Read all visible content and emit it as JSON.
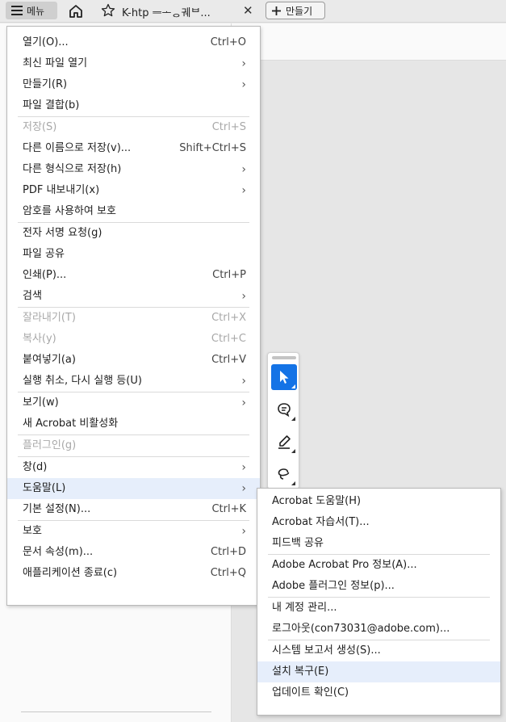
{
  "tabbar": {
    "menu_label": "메뉴",
    "tab_title": "K-htp ᆖᅩᆼ궤ᄇ...",
    "close_glyph": "✕",
    "new_tab_label": "만들기"
  },
  "main_menu": [
    {
      "type": "item",
      "label": "열기(O)...",
      "shortcut": "Ctrl+O"
    },
    {
      "type": "item",
      "label": "최신 파일 열기",
      "submenu": true
    },
    {
      "type": "item",
      "label": "만들기(R)",
      "submenu": true
    },
    {
      "type": "item",
      "label": "파일 결합(b)"
    },
    {
      "type": "sep"
    },
    {
      "type": "item",
      "label": "저장(S)",
      "shortcut": "Ctrl+S",
      "disabled": true
    },
    {
      "type": "item",
      "label": "다른 이름으로 저장(v)...",
      "shortcut": "Shift+Ctrl+S"
    },
    {
      "type": "item",
      "label": "다른 형식으로 저장(h)",
      "submenu": true
    },
    {
      "type": "item",
      "label": "PDF 내보내기(x)",
      "submenu": true
    },
    {
      "type": "item",
      "label": "암호를 사용하여 보호"
    },
    {
      "type": "sep"
    },
    {
      "type": "item",
      "label": "전자 서명 요청(g)"
    },
    {
      "type": "item",
      "label": "파일 공유"
    },
    {
      "type": "item",
      "label": "인쇄(P)...",
      "shortcut": "Ctrl+P"
    },
    {
      "type": "item",
      "label": "검색",
      "submenu": true
    },
    {
      "type": "sep"
    },
    {
      "type": "item",
      "label": "잘라내기(T)",
      "shortcut": "Ctrl+X",
      "disabled": true
    },
    {
      "type": "item",
      "label": "복사(y)",
      "shortcut": "Ctrl+C",
      "disabled": true
    },
    {
      "type": "item",
      "label": "붙여넣기(a)",
      "shortcut": "Ctrl+V"
    },
    {
      "type": "item",
      "label": "실행 취소, 다시 실행 등(U)",
      "submenu": true
    },
    {
      "type": "sep"
    },
    {
      "type": "item",
      "label": "보기(w)",
      "submenu": true
    },
    {
      "type": "item",
      "label": "새 Acrobat 비활성화"
    },
    {
      "type": "sep"
    },
    {
      "type": "item",
      "label": "플러그인(g)",
      "disabled": true
    },
    {
      "type": "sep"
    },
    {
      "type": "item",
      "label": "창(d)",
      "submenu": true
    },
    {
      "type": "item",
      "label": "도움말(L)",
      "submenu": true,
      "highlighted": true
    },
    {
      "type": "item",
      "label": "기본 설정(N)...",
      "shortcut": "Ctrl+K"
    },
    {
      "type": "sep"
    },
    {
      "type": "item",
      "label": "보호",
      "submenu": true
    },
    {
      "type": "item",
      "label": "문서 속성(m)...",
      "shortcut": "Ctrl+D"
    },
    {
      "type": "item",
      "label": "애플리케이션 종료(c)",
      "shortcut": "Ctrl+Q"
    }
  ],
  "help_submenu": [
    {
      "type": "item",
      "label": "Acrobat 도움말(H)"
    },
    {
      "type": "item",
      "label": "Acrobat 자습서(T)..."
    },
    {
      "type": "item",
      "label": "피드백 공유"
    },
    {
      "type": "sep"
    },
    {
      "type": "item",
      "label": "Adobe Acrobat Pro 정보(A)..."
    },
    {
      "type": "item",
      "label": "Adobe 플러그인 정보(p)..."
    },
    {
      "type": "sep"
    },
    {
      "type": "item",
      "label": "내 계정 관리..."
    },
    {
      "type": "item",
      "label": "로그아웃(con73031@adobe.com)..."
    },
    {
      "type": "sep"
    },
    {
      "type": "item",
      "label": "시스템 보고서 생성(S)..."
    },
    {
      "type": "item",
      "label": "설치 복구(E)",
      "highlighted": true
    },
    {
      "type": "item",
      "label": "업데이트 확인(C)"
    }
  ],
  "floating_toolbar": {
    "tools": [
      "select-pointer-icon",
      "comment-icon",
      "highlighter-pen-icon",
      "lasso-draw-icon"
    ],
    "accent_color": "#1473e6"
  },
  "colors": {
    "menu_highlight": "#e6eefb",
    "disabled_text": "#a8a8a8"
  },
  "glyphs": {
    "submenu_arrow": "›"
  }
}
